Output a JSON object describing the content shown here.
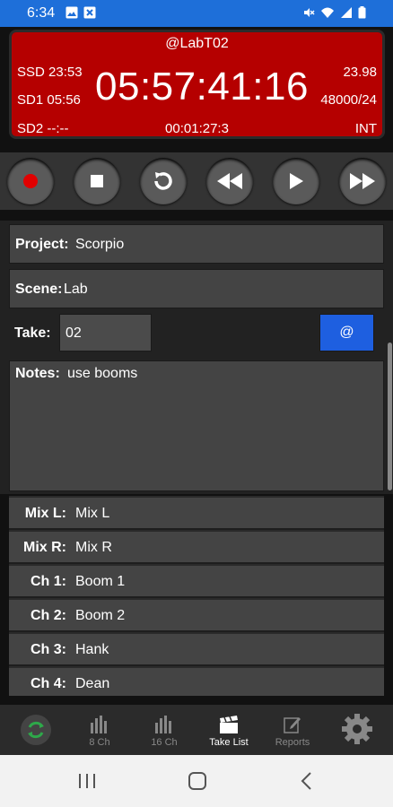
{
  "status": {
    "time": "6:34"
  },
  "display": {
    "top": "@LabT02",
    "ssd": "SSD 23:53",
    "sd1": "SD1 05:56",
    "sd2": "SD2 --:--",
    "timecode": "05:57:41:16",
    "fps": "23.98",
    "samplerate": "48000/24",
    "elapsed": "00:01:27:3",
    "int": "INT",
    "background": "#b50000"
  },
  "transport": {
    "buttons": [
      "record-icon",
      "stop-icon",
      "undo-icon",
      "rewind-icon",
      "play-icon",
      "fast-forward-icon"
    ]
  },
  "form": {
    "project_label": "Project:",
    "project_value": "Scorpio",
    "scene_label": "Scene:",
    "scene_value": "Lab",
    "take_label": "Take:",
    "take_value": "02",
    "at_button": "@",
    "notes_label": "Notes:",
    "notes_value": "use booms"
  },
  "channels": [
    {
      "label": "Mix L:",
      "value": "Mix L"
    },
    {
      "label": "Mix R:",
      "value": "Mix R"
    },
    {
      "label": "Ch 1:",
      "value": "Boom 1"
    },
    {
      "label": "Ch 2:",
      "value": "Boom 2"
    },
    {
      "label": "Ch 3:",
      "value": "Hank"
    },
    {
      "label": "Ch 4:",
      "value": "Dean"
    }
  ],
  "nav": {
    "ch8": "8 Ch",
    "ch16": "16 Ch",
    "takelist": "Take List",
    "reports": "Reports"
  },
  "colors": {
    "accent": "#1e5fe0",
    "statusbar": "#1e6fd9",
    "record": "#e00000"
  }
}
